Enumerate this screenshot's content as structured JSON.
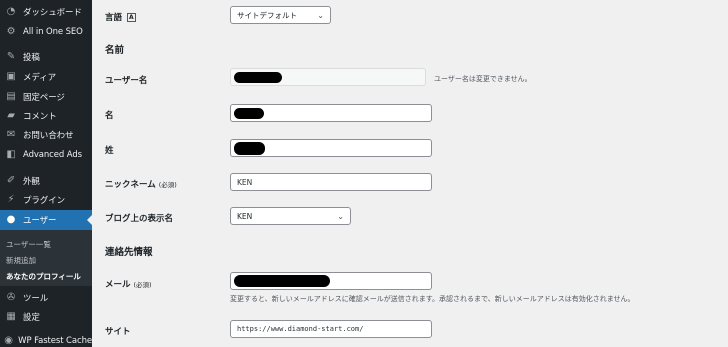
{
  "sidebar": {
    "items": [
      {
        "label": "ダッシュボード",
        "icon": "dashboard-icon"
      },
      {
        "label": "All in One SEO",
        "icon": "gear-icon"
      },
      {
        "label": "投稿",
        "icon": "pin-icon"
      },
      {
        "label": "メディア",
        "icon": "media-icon"
      },
      {
        "label": "固定ページ",
        "icon": "page-icon"
      },
      {
        "label": "コメント",
        "icon": "comment-icon"
      },
      {
        "label": "お問い合わせ",
        "icon": "mail-icon"
      },
      {
        "label": "Advanced Ads",
        "icon": "ads-icon"
      },
      {
        "label": "外観",
        "icon": "brush-icon"
      },
      {
        "label": "プラグイン",
        "icon": "plugin-icon"
      },
      {
        "label": "ユーザー",
        "icon": "user-icon"
      },
      {
        "label": "ツール",
        "icon": "wrench-icon"
      },
      {
        "label": "設定",
        "icon": "settings-icon"
      },
      {
        "label": "WP Fastest Cache",
        "icon": "cache-icon"
      }
    ],
    "submenu": [
      {
        "label": "ユーザー一覧"
      },
      {
        "label": "新規追加"
      },
      {
        "label": "あなたのプロフィール"
      }
    ]
  },
  "form": {
    "language": {
      "label": "言語",
      "value": "サイトデフォルト"
    },
    "name_section": "名前",
    "username": {
      "label": "ユーザー名",
      "note": "ユーザー名は変更できません。"
    },
    "first_name": {
      "label": "名"
    },
    "last_name": {
      "label": "姓"
    },
    "nickname": {
      "label": "ニックネーム",
      "required": "(必須)",
      "value": "KEN"
    },
    "display_name": {
      "label": "ブログ上の表示名",
      "value": "KEN"
    },
    "contact_section": "連絡先情報",
    "email": {
      "label": "メール",
      "required": "(必須)",
      "note": "変更すると、新しいメールアドレスに確認メールが送信されます。承認されるまで、新しいメールアドレスは有効化されません。"
    },
    "website": {
      "label": "サイト",
      "value": "https://www.diamond-start.com/"
    }
  },
  "colors": {
    "sidebar_bg": "#1d2327",
    "accent": "#2271b1",
    "content_bg": "#f0f0f1"
  }
}
